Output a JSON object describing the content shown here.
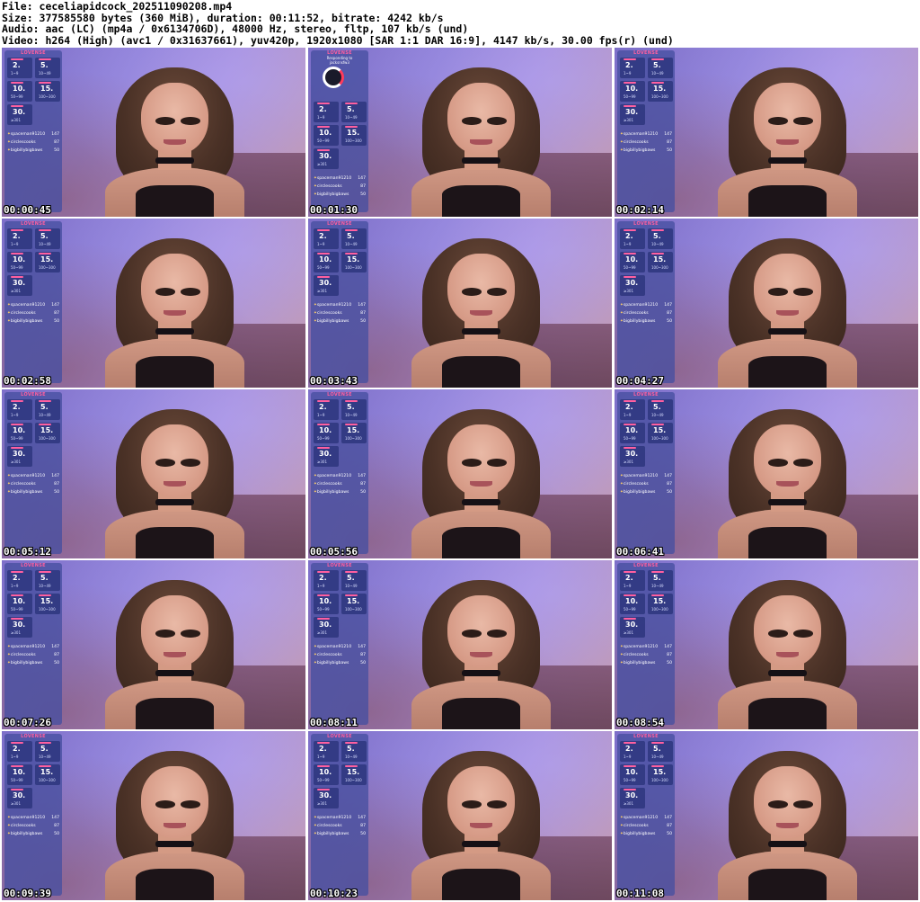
{
  "header": {
    "file": "File: ceceliapidcock_202511090208.mp4",
    "size": "Size: 377585580 bytes (360 MiB), duration: 00:11:52, bitrate: 4242 kb/s",
    "audio": "Audio: aac (LC) (mp4a / 0x6134706D), 48000 Hz, stereo, fltp, 107 kb/s (und)",
    "video": "Video: h264 (High) (avc1 / 0x31637661), yuv420p, 1920x1080 [SAR 1:1 DAR 16:9], 4147 kb/s, 30.00 fps(r) (und)"
  },
  "overlay": {
    "title": "LOVENSE",
    "tiles": [
      {
        "value": "2.",
        "range": "1~9"
      },
      {
        "value": "5.",
        "range": "10~49"
      },
      {
        "value": "10.",
        "range": "50~99"
      },
      {
        "value": "15.",
        "range": "100~300"
      },
      {
        "value": "30.",
        "range": "≥301"
      }
    ],
    "leaders": [
      {
        "name": "spaceman91210",
        "score": "147"
      },
      {
        "name": "circlescooks",
        "score": "87"
      },
      {
        "name": "bigbillybigbaws",
        "score": "50"
      }
    ],
    "responding_label": "Responding to",
    "responding_user": "jacksnsfw3"
  },
  "thumbnails": [
    {
      "timestamp": "00:00:45"
    },
    {
      "timestamp": "00:01:30"
    },
    {
      "timestamp": "00:02:14"
    },
    {
      "timestamp": "00:02:58"
    },
    {
      "timestamp": "00:03:43"
    },
    {
      "timestamp": "00:04:27"
    },
    {
      "timestamp": "00:05:12"
    },
    {
      "timestamp": "00:05:56"
    },
    {
      "timestamp": "00:06:41"
    },
    {
      "timestamp": "00:07:26"
    },
    {
      "timestamp": "00:08:11"
    },
    {
      "timestamp": "00:08:54"
    },
    {
      "timestamp": "00:09:39"
    },
    {
      "timestamp": "00:10:23"
    },
    {
      "timestamp": "00:11:08"
    }
  ]
}
